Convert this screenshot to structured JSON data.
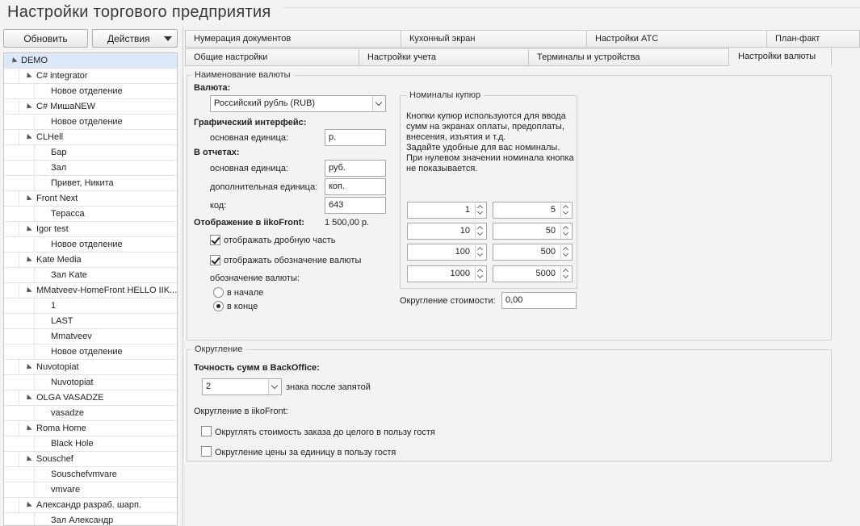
{
  "title": "Настройки торгового предприятия",
  "left_panel": {
    "refresh_label": "Обновить",
    "actions_label": "Действия",
    "tree": [
      {
        "label": "DEMO",
        "level": 0,
        "expanded": true,
        "selected": true
      },
      {
        "label": "C# integrator",
        "level": 1,
        "expanded": true
      },
      {
        "label": "Новое отделение",
        "level": 2
      },
      {
        "label": "C# МишаNEW",
        "level": 1,
        "expanded": true
      },
      {
        "label": "Новое отделение",
        "level": 2
      },
      {
        "label": "CLHell",
        "level": 1,
        "expanded": true
      },
      {
        "label": "Бар",
        "level": 2
      },
      {
        "label": "Зал",
        "level": 2
      },
      {
        "label": "Привет, Никита",
        "level": 2
      },
      {
        "label": "Front Next",
        "level": 1,
        "expanded": true
      },
      {
        "label": "Терасса",
        "level": 2
      },
      {
        "label": "Igor test",
        "level": 1,
        "expanded": true
      },
      {
        "label": "Новое отделение",
        "level": 2
      },
      {
        "label": "Kate Media",
        "level": 1,
        "expanded": true
      },
      {
        "label": "Зал Kate",
        "level": 2
      },
      {
        "label": "MMatveev-HomeFront HELLO IIK...",
        "level": 1,
        "expanded": true
      },
      {
        "label": "1",
        "level": 2
      },
      {
        "label": "LAST",
        "level": 2
      },
      {
        "label": "Mmatveev",
        "level": 2
      },
      {
        "label": "Новое отделение",
        "level": 2
      },
      {
        "label": "Nuvotopiat",
        "level": 1,
        "expanded": true
      },
      {
        "label": "Nuvotopiat",
        "level": 2
      },
      {
        "label": "OLGA VASADZE",
        "level": 1,
        "expanded": true
      },
      {
        "label": "vasadze",
        "level": 2
      },
      {
        "label": "Roma Home",
        "level": 1,
        "expanded": true
      },
      {
        "label": "Black Hole",
        "level": 2
      },
      {
        "label": "Souschef",
        "level": 1,
        "expanded": true
      },
      {
        "label": "Souschefvmvare",
        "level": 2
      },
      {
        "label": "vmvare",
        "level": 2
      },
      {
        "label": "Александр разраб. шарп.",
        "level": 1,
        "expanded": true
      },
      {
        "label": "Зал Александр",
        "level": 2
      }
    ]
  },
  "tabs_row1": [
    "Нумерация документов",
    "Кухонный экран",
    "Настройки АТС",
    "План-факт"
  ],
  "tabs_row2": [
    "Общие настройки",
    "Настройки учета",
    "Терминалы и устройства",
    "Настройки валюты"
  ],
  "currency_group": {
    "title": "Наименование валюты",
    "currency_label": "Валюта:",
    "currency_value": "Российский рубль (RUB)",
    "gui_label": "Графический интерфейс:",
    "gui_main_unit_label": "основная единица:",
    "gui_main_unit_value": "р.",
    "reports_label": "В отчетах:",
    "rep_main_unit_label": "основная единица:",
    "rep_main_unit_value": "руб.",
    "rep_extra_unit_label": "дополнительная единица:",
    "rep_extra_unit_value": "коп.",
    "code_label": "код:",
    "code_value": "643",
    "front_display_label": "Отображение в iikoFront:",
    "front_display_value": "1 500,00 р.",
    "show_fraction_label": "отображать дробную часть",
    "show_fraction_checked": true,
    "show_symbol_label": "отображать обозначение валюты",
    "show_symbol_checked": true,
    "symbol_position_label": "обозначение валюты:",
    "pos_start_label": "в начале",
    "pos_end_label": "в конце",
    "selected_position": "end",
    "denominations": {
      "title": "Номиналы купюр",
      "note": "Кнопки купюр используются для ввода\nсумм на экранах оплаты, предоплаты,\nвнесения, изъятия и т.д.\nЗадайте удобные для вас номиналы.\nПри нулевом значении номинала кнопка\nне показывается.",
      "values": [
        "1",
        "5",
        "10",
        "50",
        "100",
        "500",
        "1000",
        "5000"
      ]
    },
    "rounding_cost_label": "Округление стоимости:",
    "rounding_cost_value": "0,00"
  },
  "rounding_group": {
    "title": "Округление",
    "precision_label": "Точность сумм в BackOffice:",
    "precision_value": "2",
    "precision_suffix": "знака после запятой",
    "front_label": "Округление в iikoFront:",
    "round_order_label": "Округлять стоимость заказа до целого в пользу гостя",
    "round_order_checked": false,
    "round_unit_label": "Округление цены за единицу в пользу гостя",
    "round_unit_checked": false
  }
}
